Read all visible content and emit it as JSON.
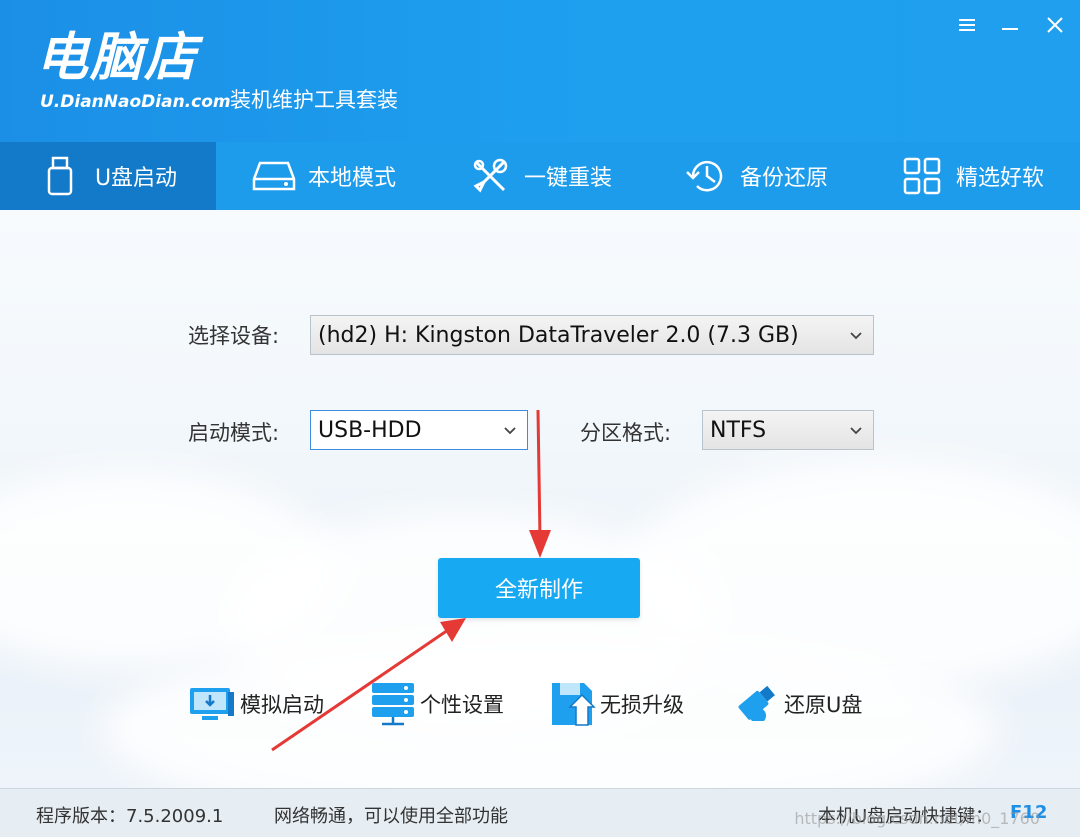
{
  "app": {
    "logo_main": "电脑店",
    "logo_url": "U.DianNaoDian.com",
    "tagline": "装机维护工具套装"
  },
  "window_controls": [
    "menu-icon",
    "minimize-icon",
    "close-icon"
  ],
  "nav": {
    "items": [
      {
        "label": "U盘启动",
        "icon": "usb-drive-icon",
        "active": true
      },
      {
        "label": "本地模式",
        "icon": "hard-disk-icon",
        "active": false
      },
      {
        "label": "一键重装",
        "icon": "tools-icon",
        "active": false
      },
      {
        "label": "备份还原",
        "icon": "history-icon",
        "active": false
      },
      {
        "label": "精选好软",
        "icon": "apps-grid-icon",
        "active": false
      }
    ]
  },
  "form": {
    "device_label": "选择设备:",
    "device_value": "(hd2) H: Kingston DataTraveler 2.0 (7.3 GB)",
    "boot_mode_label": "启动模式:",
    "boot_mode_value": "USB-HDD",
    "partition_label": "分区格式:",
    "partition_value": "NTFS"
  },
  "primary_button": "全新制作",
  "tools": [
    {
      "label": "模拟启动",
      "icon": "monitor-download-icon"
    },
    {
      "label": "个性设置",
      "icon": "server-settings-icon"
    },
    {
      "label": "无损升级",
      "icon": "floppy-upgrade-icon"
    },
    {
      "label": "还原U盘",
      "icon": "usb-restore-icon"
    }
  ],
  "status": {
    "version": "程序版本：7.5.2009.1",
    "network": "网络畅通，可以使用全部功能",
    "hotkey_label": "本机U盘启动快捷键：",
    "hotkey_value": "F12",
    "watermark": "https://blog.csdn.net/m0_1760"
  },
  "colors": {
    "header": "#1e9cec",
    "nav_active": "#1379c9",
    "primary": "#18a9f3",
    "annotation_arrow": "#e53935"
  }
}
